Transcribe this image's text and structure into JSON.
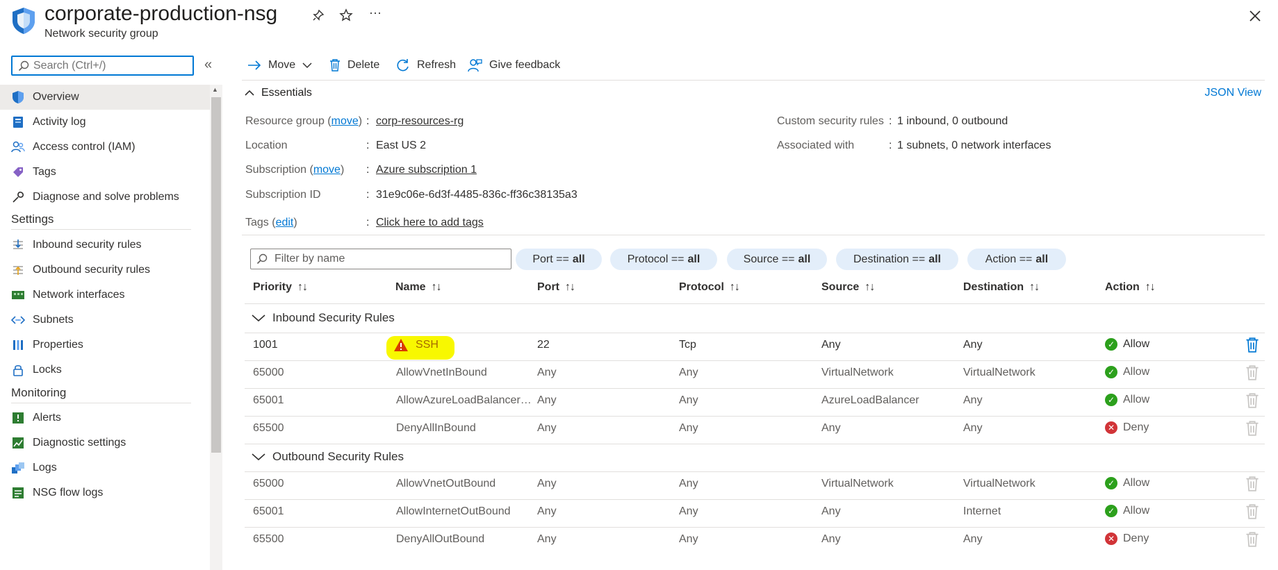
{
  "header": {
    "title": "corporate-production-nsg",
    "subtitle": "Network security group"
  },
  "sidebar": {
    "search_placeholder": "Search (Ctrl+/)",
    "items": [
      {
        "label": "Overview"
      },
      {
        "label": "Activity log"
      },
      {
        "label": "Access control (IAM)"
      },
      {
        "label": "Tags"
      },
      {
        "label": "Diagnose and solve problems"
      }
    ],
    "settings_title": "Settings",
    "settings_items": [
      {
        "label": "Inbound security rules"
      },
      {
        "label": "Outbound security rules"
      },
      {
        "label": "Network interfaces"
      },
      {
        "label": "Subnets"
      },
      {
        "label": "Properties"
      },
      {
        "label": "Locks"
      }
    ],
    "monitoring_title": "Monitoring",
    "monitoring_items": [
      {
        "label": "Alerts"
      },
      {
        "label": "Diagnostic settings"
      },
      {
        "label": "Logs"
      },
      {
        "label": "NSG flow logs"
      }
    ]
  },
  "toolbar": {
    "move": "Move",
    "delete": "Delete",
    "refresh": "Refresh",
    "feedback": "Give feedback"
  },
  "essentials": {
    "title": "Essentials",
    "json_view": "JSON View",
    "resource_group_label": "Resource group",
    "move_link": "move",
    "resource_group_value": "corp-resources-rg",
    "location_label": "Location",
    "location_value": "East US 2",
    "subscription_label": "Subscription",
    "subscription_value": "Azure subscription 1",
    "subscription_id_label": "Subscription ID",
    "subscription_id_value": "31e9c06e-6d3f-4485-836c-ff36c38135a3",
    "tags_label": "Tags",
    "edit_link": "edit",
    "tags_value": "Click here to add tags",
    "custom_rules_label": "Custom security rules",
    "custom_rules_value": "1 inbound, 0 outbound",
    "associated_label": "Associated with",
    "associated_value": "1 subnets, 0 network interfaces",
    "paren_open": "(",
    "paren_close": ")",
    "colon": ":"
  },
  "filters": {
    "placeholder": "Filter by name",
    "pills": [
      {
        "key": "Port ==",
        "value": "all"
      },
      {
        "key": "Protocol ==",
        "value": "all"
      },
      {
        "key": "Source ==",
        "value": "all"
      },
      {
        "key": "Destination ==",
        "value": "all"
      },
      {
        "key": "Action ==",
        "value": "all"
      }
    ]
  },
  "table": {
    "columns": [
      "Priority",
      "Name",
      "Port",
      "Protocol",
      "Source",
      "Destination",
      "Action"
    ],
    "sort_glyph": "↑↓",
    "inbound_title": "Inbound Security Rules",
    "outbound_title": "Outbound Security Rules",
    "inbound": [
      {
        "priority": "1001",
        "name": "SSH",
        "port": "22",
        "protocol": "Tcp",
        "source": "Any",
        "destination": "Any",
        "action": "Allow"
      },
      {
        "priority": "65000",
        "name": "AllowVnetInBound",
        "port": "Any",
        "protocol": "Any",
        "source": "VirtualNetwork",
        "destination": "VirtualNetwork",
        "action": "Allow"
      },
      {
        "priority": "65001",
        "name": "AllowAzureLoadBalancer…",
        "port": "Any",
        "protocol": "Any",
        "source": "AzureLoadBalancer",
        "destination": "Any",
        "action": "Allow"
      },
      {
        "priority": "65500",
        "name": "DenyAllInBound",
        "port": "Any",
        "protocol": "Any",
        "source": "Any",
        "destination": "Any",
        "action": "Deny"
      }
    ],
    "outbound": [
      {
        "priority": "65000",
        "name": "AllowVnetOutBound",
        "port": "Any",
        "protocol": "Any",
        "source": "VirtualNetwork",
        "destination": "VirtualNetwork",
        "action": "Allow"
      },
      {
        "priority": "65001",
        "name": "AllowInternetOutBound",
        "port": "Any",
        "protocol": "Any",
        "source": "Any",
        "destination": "Internet",
        "action": "Allow"
      },
      {
        "priority": "65500",
        "name": "DenyAllOutBound",
        "port": "Any",
        "protocol": "Any",
        "source": "Any",
        "destination": "Any",
        "action": "Deny"
      }
    ]
  },
  "colors": {
    "accent": "#0078d4",
    "allow": "#2ca01c",
    "deny": "#d13438",
    "warning": "#d83b01",
    "highlight": "#f8f800"
  }
}
